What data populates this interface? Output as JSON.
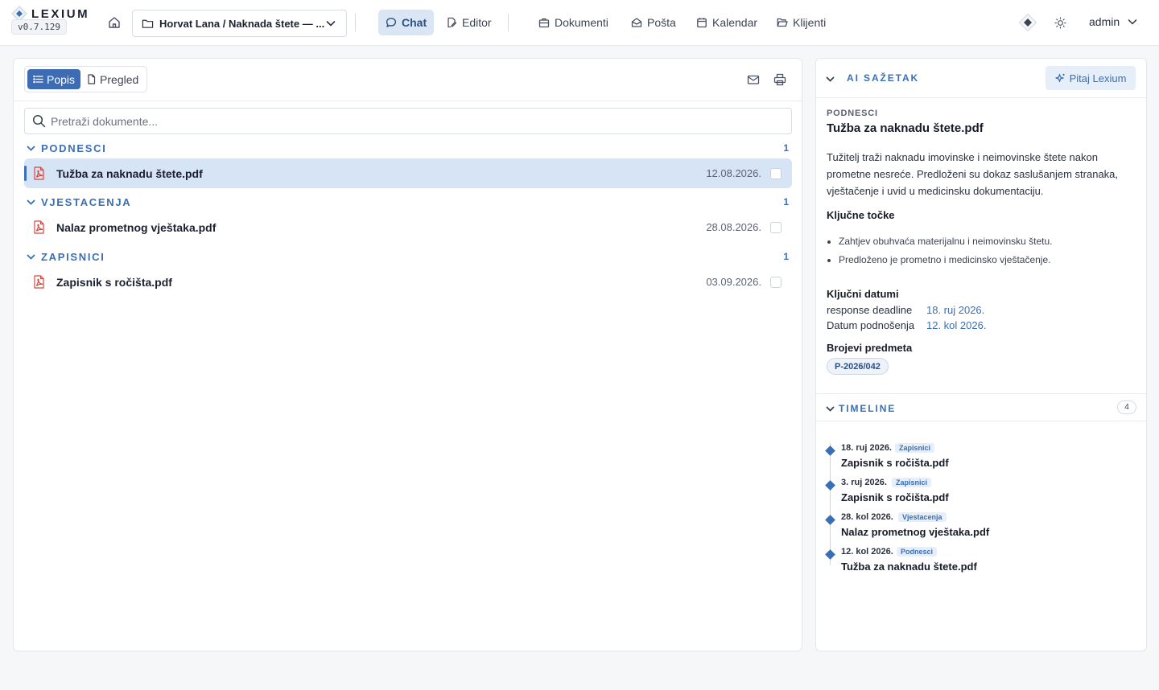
{
  "app": {
    "name": "LEXIUM",
    "version": "v0.7.129",
    "accent": "#3a6fb5"
  },
  "header": {
    "case_selector": "Horvat Lana / Naknada štete — ...",
    "nav": [
      {
        "label": "Chat",
        "icon": "chat-icon",
        "active": true
      },
      {
        "label": "Editor",
        "icon": "edit-icon",
        "active": false
      },
      {
        "label": "Dokumenti",
        "icon": "briefcase-icon",
        "active": false
      },
      {
        "label": "Pošta",
        "icon": "inbox-icon",
        "active": false
      },
      {
        "label": "Kalendar",
        "icon": "calendar-icon",
        "active": false
      },
      {
        "label": "Klijenti",
        "icon": "folder-open-icon",
        "active": false
      }
    ],
    "user": "admin"
  },
  "documents": {
    "view_tabs": [
      {
        "label": "Popis",
        "icon": "list-icon",
        "active": true
      },
      {
        "label": "Pregled",
        "icon": "file-icon",
        "active": false
      }
    ],
    "search_placeholder": "Pretraži dokumente...",
    "groups": [
      {
        "title": "PODNESCI",
        "count": "1",
        "items": [
          {
            "name": "Tužba za naknadu štete.pdf",
            "date": "12.08.2026.",
            "selected": true
          }
        ]
      },
      {
        "title": "VJESTACENJA",
        "count": "1",
        "items": [
          {
            "name": "Nalaz prometnog vještaka.pdf",
            "date": "28.08.2026.",
            "selected": false
          }
        ]
      },
      {
        "title": "ZAPISNICI",
        "count": "1",
        "items": [
          {
            "name": "Zapisnik s ročišta.pdf",
            "date": "03.09.2026.",
            "selected": false
          }
        ]
      }
    ]
  },
  "summary": {
    "title": "AI SAŽETAK",
    "ask_button": "Pitaj Lexium",
    "doc_category": "PODNESCI",
    "doc_title": "Tužba za naknadu štete.pdf",
    "text": "Tužitelj traži naknadu imovinske i neimovinske štete nakon prometne nesreće. Predloženi su dokaz saslušanjem stranaka, vještačenje i uvid u medicinsku dokumentaciju.",
    "key_points_title": "Ključne točke",
    "key_points": [
      "Zahtjev obuhvaća materijalnu i neimovinsku štetu.",
      "Predloženo je prometno i medicinsko vještačenje."
    ],
    "key_dates_title": "Ključni datumi",
    "key_dates": [
      {
        "label": "response deadline",
        "value": "18. ruj 2026."
      },
      {
        "label": "Datum podnošenja",
        "value": "12. kol 2026."
      }
    ],
    "case_numbers_title": "Brojevi predmeta",
    "case_numbers": [
      "P-2026/042"
    ]
  },
  "timeline": {
    "title": "TIMELINE",
    "count": "4",
    "items": [
      {
        "date": "18. ruj 2026.",
        "tag": "Zapisnici",
        "name": "Zapisnik s ročišta.pdf"
      },
      {
        "date": "3. ruj 2026.",
        "tag": "Zapisnici",
        "name": "Zapisnik s ročišta.pdf"
      },
      {
        "date": "28. kol 2026.",
        "tag": "Vjestacenja",
        "name": "Nalaz prometnog vještaka.pdf"
      },
      {
        "date": "12. kol 2026.",
        "tag": "Podnesci",
        "name": "Tužba za naknadu štete.pdf"
      }
    ]
  }
}
